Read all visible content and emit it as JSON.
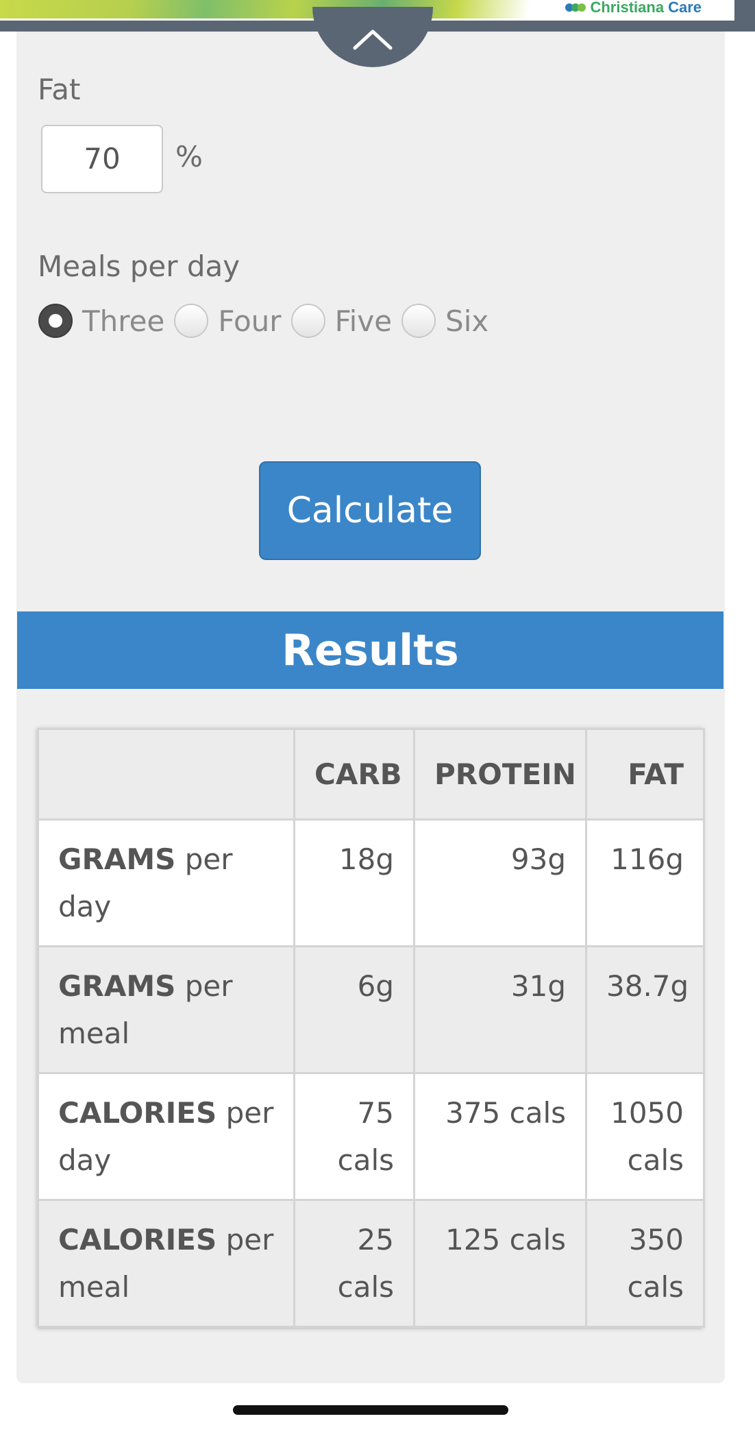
{
  "ad": {
    "logo_part1": "Christiana",
    "logo_part2": "Care"
  },
  "form": {
    "fat_label": "Fat",
    "fat_value": "70",
    "fat_unit": "%",
    "meals_label": "Meals per day",
    "meal_options": [
      "Three",
      "Four",
      "Five",
      "Six"
    ],
    "meal_selected": "Three",
    "calculate_label": "Calculate"
  },
  "results": {
    "title": "Results",
    "headers": [
      "",
      "CARB",
      "PROTEIN",
      "FAT"
    ],
    "rows": [
      {
        "bold": "GRAMS",
        "rest": " per day",
        "carb": "18g",
        "protein": "93g",
        "fat": "116g"
      },
      {
        "bold": "GRAMS",
        "rest": " per meal",
        "carb": "6g",
        "protein": "31g",
        "fat": "38.7g"
      },
      {
        "bold": "CALORIES",
        "rest": " per day",
        "carb": "75 cals",
        "protein": "375 cals",
        "fat": "1050 cals"
      },
      {
        "bold": "CALORIES",
        "rest": " per meal",
        "carb": "25 cals",
        "protein": "125 cals",
        "fat": "350 cals"
      }
    ]
  },
  "colors": {
    "accent": "#3b86c8",
    "banner": "#5a6673",
    "card_bg": "#efefef"
  }
}
